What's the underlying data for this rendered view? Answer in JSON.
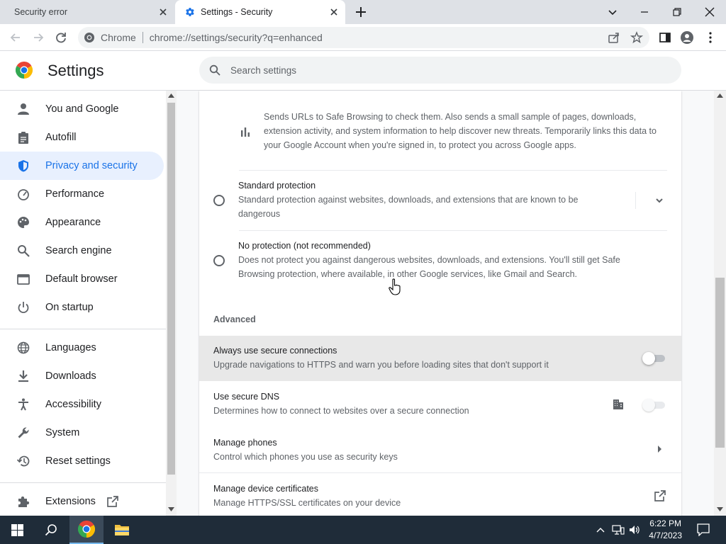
{
  "tabs": [
    {
      "title": "Security error",
      "active": false
    },
    {
      "title": "Settings - Security",
      "active": true
    }
  ],
  "omnibox": {
    "chip": "Chrome",
    "url": "chrome://settings/security?q=enhanced"
  },
  "header": {
    "title": "Settings",
    "search_placeholder": "Search settings"
  },
  "sidebar": {
    "items": [
      {
        "label": "You and Google",
        "icon": "person-icon"
      },
      {
        "label": "Autofill",
        "icon": "clipboard-icon"
      },
      {
        "label": "Privacy and security",
        "icon": "shield-icon",
        "active": true
      },
      {
        "label": "Performance",
        "icon": "speedometer-icon"
      },
      {
        "label": "Appearance",
        "icon": "palette-icon"
      },
      {
        "label": "Search engine",
        "icon": "search-icon"
      },
      {
        "label": "Default browser",
        "icon": "browser-window-icon"
      },
      {
        "label": "On startup",
        "icon": "power-icon"
      },
      {
        "label": "Languages",
        "icon": "globe-icon"
      },
      {
        "label": "Downloads",
        "icon": "download-icon"
      },
      {
        "label": "Accessibility",
        "icon": "accessibility-icon"
      },
      {
        "label": "System",
        "icon": "wrench-icon"
      },
      {
        "label": "Reset settings",
        "icon": "reset-history-icon"
      },
      {
        "label": "Extensions",
        "icon": "puzzle-icon"
      }
    ]
  },
  "content": {
    "enhanced_desc": "Sends URLs to Safe Browsing to check them. Also sends a small sample of pages, downloads, extension activity, and system information to help discover new threats. Temporarily links this data to your Google Account when you're signed in, to protect you across Google apps.",
    "standard": {
      "title": "Standard protection",
      "desc": "Standard protection against websites, downloads, and extensions that are known to be dangerous"
    },
    "noprotection": {
      "title": "No protection (not recommended)",
      "desc": "Does not protect you against dangerous websites, downloads, and extensions. You'll still get Safe Browsing protection, where available, in other Google services, like Gmail and Search."
    },
    "advanced_heading": "Advanced",
    "https": {
      "title": "Always use secure connections",
      "desc": "Upgrade navigations to HTTPS and warn you before loading sites that don't support it",
      "enabled": false
    },
    "dns": {
      "title": "Use secure DNS",
      "desc": "Determines how to connect to websites over a secure connection",
      "enabled": false
    },
    "phones": {
      "title": "Manage phones",
      "desc": "Control which phones you use as security keys"
    },
    "certs": {
      "title": "Manage device certificates",
      "desc": "Manage HTTPS/SSL certificates on your device"
    }
  },
  "taskbar": {
    "time": "6:22 PM",
    "date": "4/7/2023"
  },
  "colors": {
    "accent": "#1a73e8",
    "active_nav_bg": "#e8f0fe",
    "taskbar": "#1f2c39"
  }
}
